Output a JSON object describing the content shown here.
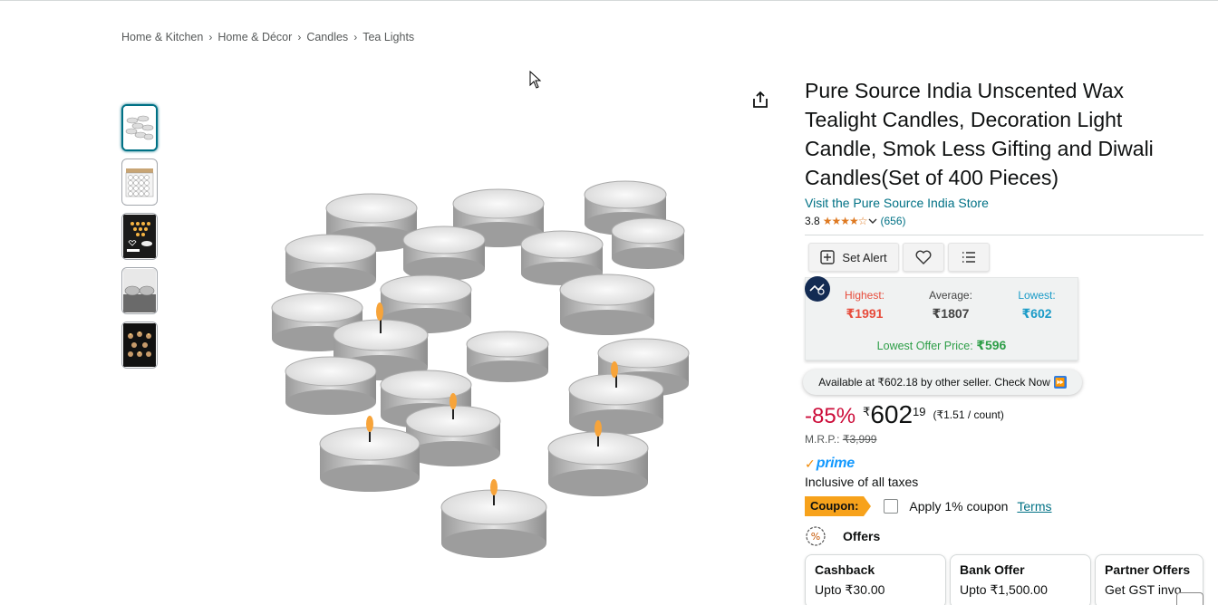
{
  "breadcrumb": [
    "Home & Kitchen",
    "Home & Décor",
    "Candles",
    "Tea Lights"
  ],
  "breadcrumb_separator": "›",
  "product": {
    "title": "Pure Source India Unscented Wax Tealight Candles, Decoration Light Candle, Smok Less Gifting and Diwali Candles(Set of 400 Pieces)",
    "store_link": "Visit the Pure Source India Store",
    "rating": "3.8",
    "rating_value": 3.8,
    "review_count": "(656)"
  },
  "toolbar": {
    "set_alert_label": "Set Alert",
    "icons": [
      "plus-square-icon",
      "heart-icon",
      "list-icon"
    ]
  },
  "price_history": {
    "highest_label": "Highest:",
    "highest_value": "₹1991",
    "average_label": "Average:",
    "average_value": "₹1807",
    "lowest_label": "Lowest:",
    "lowest_value": "₹602",
    "offer_label": "Lowest Offer Price:",
    "offer_value": "₹596"
  },
  "availability": {
    "text": "Available at ₹602.18 by other seller. Check Now"
  },
  "pricing": {
    "discount": "-85%",
    "currency": "₹",
    "whole": "602",
    "fraction": "19",
    "per_unit": "(₹1.51 / count)",
    "mrp_label": "M.R.P.:",
    "mrp_value": "₹3,999"
  },
  "prime": {
    "label": "prime"
  },
  "taxes": "Inclusive of all taxes",
  "coupon": {
    "tag": "Coupon:",
    "text": "Apply 1% coupon",
    "terms": "Terms"
  },
  "offers": {
    "title": "Offers",
    "cards": [
      {
        "title": "Cashback",
        "sub": "Upto ₹30.00"
      },
      {
        "title": "Bank Offer",
        "sub": "Upto ₹1,500.00"
      },
      {
        "title": "Partner Offers",
        "sub": "Get GST invo"
      }
    ]
  },
  "colors": {
    "link": "#007185",
    "discount": "#cc0c39",
    "highest": "#e74c3c",
    "lowest": "#1a9bc7",
    "offer_green": "#2e9e48",
    "coupon": "#f7a21b",
    "star": "#de7921"
  }
}
